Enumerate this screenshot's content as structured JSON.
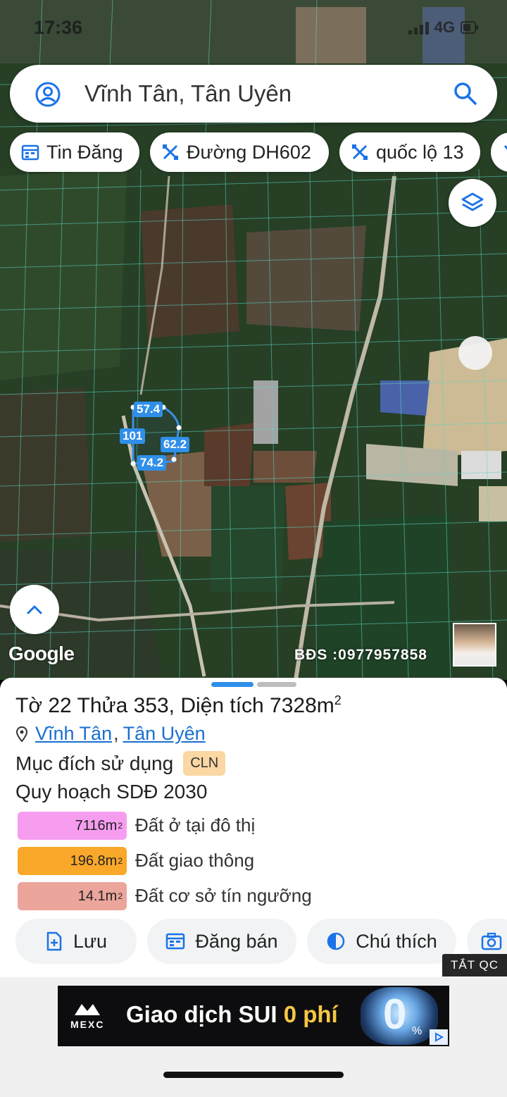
{
  "status_bar": {
    "time": "17:36",
    "network": "4G"
  },
  "search": {
    "text": "Vĩnh Tân, Tân Uyên"
  },
  "chips": [
    {
      "label": "Tin Đăng",
      "icon": "calendar-icon"
    },
    {
      "label": "Đường DH602",
      "icon": "tools-icon"
    },
    {
      "label": "quốc lộ 13",
      "icon": "tools-icon"
    }
  ],
  "map": {
    "plot_labels": {
      "top": "57.4",
      "left": "101",
      "right": "62.2",
      "bottom": "74.2"
    },
    "google_logo": "Google",
    "watermark": "BĐS :0977957858"
  },
  "parcel": {
    "title": "Tờ 22 Thửa 353, Diện tích 7328m",
    "title_sup": "2",
    "location": {
      "commune": "Vĩnh Tân",
      "separator": ",",
      "district": "Tân Uyên"
    },
    "purpose_label": "Mục đích sử dụng",
    "purpose_code": "CLN",
    "plan_label": "Quy hoạch SDĐ 2030",
    "zones": [
      {
        "area": "7116m",
        "sup": "2",
        "label": "Đất ở tại đô thị",
        "color": "#f79df0"
      },
      {
        "area": "196.8m",
        "sup": "2",
        "label": "Đất giao thông",
        "color": "#f9a829"
      },
      {
        "area": "14.1m",
        "sup": "2",
        "label": "Đất cơ sở tín ngưỡng",
        "color": "#eca59b"
      }
    ]
  },
  "actions": {
    "save": "Lưu",
    "post": "Đăng bán",
    "legend": "Chú thích"
  },
  "ad": {
    "close_label": "TẮT QC",
    "brand": "MEXC",
    "headline_main": "Giao dịch SUI",
    "headline_highlight": "0 phí",
    "graphic_text": "0",
    "graphic_pct": "%"
  },
  "colors": {
    "accent": "#1a73e8",
    "plot_label_bg": "#2f8fe9",
    "badge_bg": "#fbd7a3"
  }
}
